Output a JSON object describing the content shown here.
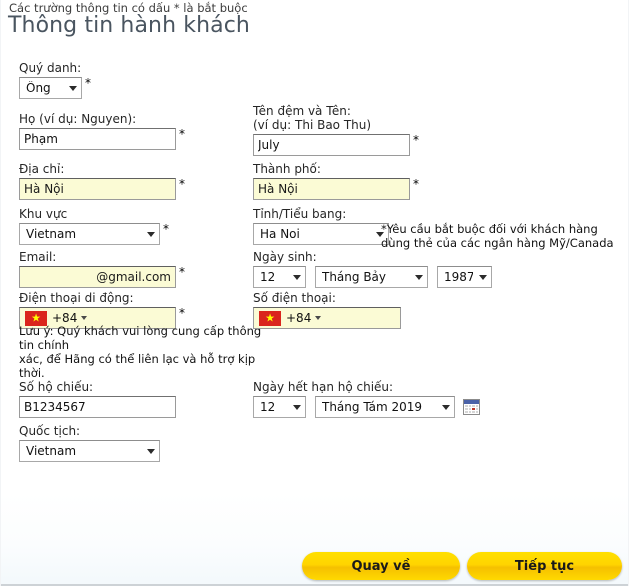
{
  "header": {
    "required_note": "Các trường thông tin có dấu * là bắt buộc",
    "title": "Thông tin hành khách"
  },
  "fields": {
    "title_salutation": {
      "label": "Quý danh:",
      "value": "Ông",
      "required_mark": "*"
    },
    "last_name": {
      "label": "Họ (ví dụ: Nguyen):",
      "value": "Phạm",
      "required_mark": "*"
    },
    "first_name": {
      "label": "Tên đệm và Tên:",
      "label_sub": "(ví dụ: Thi Bao Thu)",
      "value": "July",
      "required_mark": "*"
    },
    "address": {
      "label": "Địa chỉ:",
      "value": "Hà Nội",
      "required_mark": "*"
    },
    "city": {
      "label": "Thành phố:",
      "value": "Hà Nội",
      "required_mark": "*"
    },
    "region": {
      "label": "Khu vực",
      "value": "Vietnam",
      "required_mark": "*"
    },
    "state": {
      "label": "Tỉnh/Tiểu bang:",
      "value": "Ha Noi"
    },
    "email": {
      "label": "Email:",
      "value": "@gmail.com",
      "required_mark": "*"
    },
    "dob": {
      "label": "Ngày sinh:",
      "day": "12",
      "month": "Tháng Bảy",
      "year": "1987"
    },
    "mobile": {
      "label": "Điện thoại di động:",
      "dial_code": "+84",
      "value": "",
      "required_mark": "*",
      "flag": "vietnam-flag-icon"
    },
    "phone": {
      "label": "Số điện thoại:",
      "dial_code": "+84",
      "value": "",
      "flag": "vietnam-flag-icon"
    },
    "passport_no": {
      "label": "Số hộ chiếu:",
      "value": "B1234567"
    },
    "passport_expiry": {
      "label": "Ngày hết hạn hộ chiếu:",
      "day": "12",
      "month_year": "Tháng Tám 2019",
      "calendar_icon": "calendar-icon"
    },
    "nationality": {
      "label": "Quốc tịch:",
      "value": "Vietnam"
    }
  },
  "notes": {
    "state_warning_line1": "*Yêu cầu bắt buộc đối với khách hàng",
    "state_warning_line2": "dùng thẻ của các ngân hàng Mỹ/Canada",
    "mobile_note_line1": "Lưu ý: Quý khách vui lòng cung cấp thông",
    "mobile_note_line2": "tin chính",
    "mobile_note_line3": "xác, để Hãng có thể liên lạc và hỗ trợ kịp",
    "mobile_note_line4": "thời."
  },
  "buttons": {
    "back": "Quay về",
    "next": "Tiếp tục"
  },
  "colors": {
    "autofill_yellow": "#fbfbd5",
    "button_yellow": "#ffd400",
    "title_grey": "#4a5560",
    "flag_red": "#da251d",
    "flag_star": "#ffff00"
  }
}
